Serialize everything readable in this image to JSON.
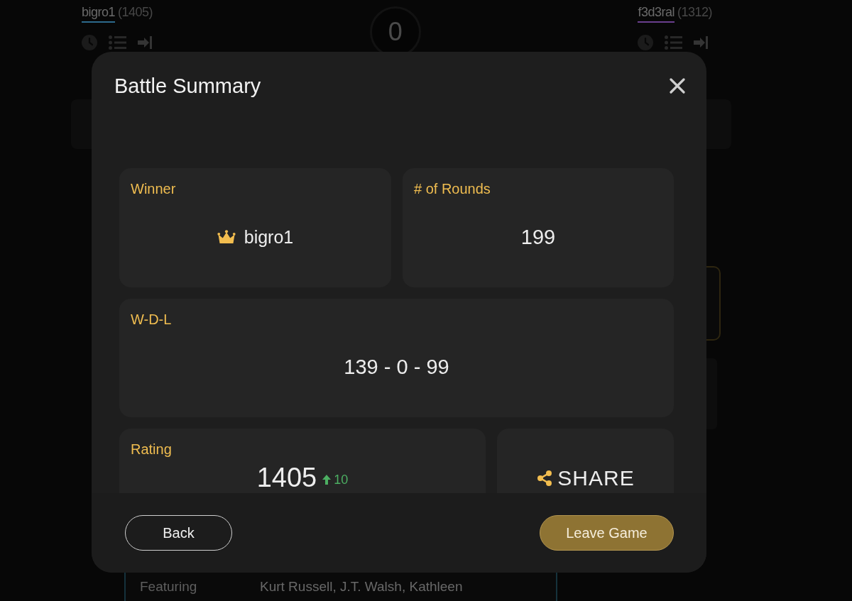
{
  "players": [
    {
      "name": "bigro1",
      "rating": "(1405)",
      "color": "#2d6a8c"
    },
    {
      "name": "f3d3ral",
      "rating": "(1312)",
      "color": "#6a3f8e"
    }
  ],
  "score": "0",
  "movie_card": {
    "label": "Featuring",
    "value": "Kurt Russell, J.T. Walsh, Kathleen"
  },
  "dialog": {
    "title": "Battle Summary",
    "stats": [
      {
        "kind": "winner",
        "label": "Winner",
        "value": "bigro1"
      },
      {
        "kind": "plain",
        "label": "# of Rounds",
        "value": "199"
      },
      {
        "kind": "plain",
        "label": "W-D-L",
        "value": "139 - 0 - 99"
      },
      {
        "kind": "rating",
        "label": "Rating",
        "value": "1405",
        "change": "10"
      },
      {
        "kind": "share",
        "label": "SHARE"
      }
    ],
    "buttons": [
      {
        "kind": "outline",
        "label": "Back"
      },
      {
        "kind": "primary",
        "label": "Leave Game"
      }
    ]
  }
}
